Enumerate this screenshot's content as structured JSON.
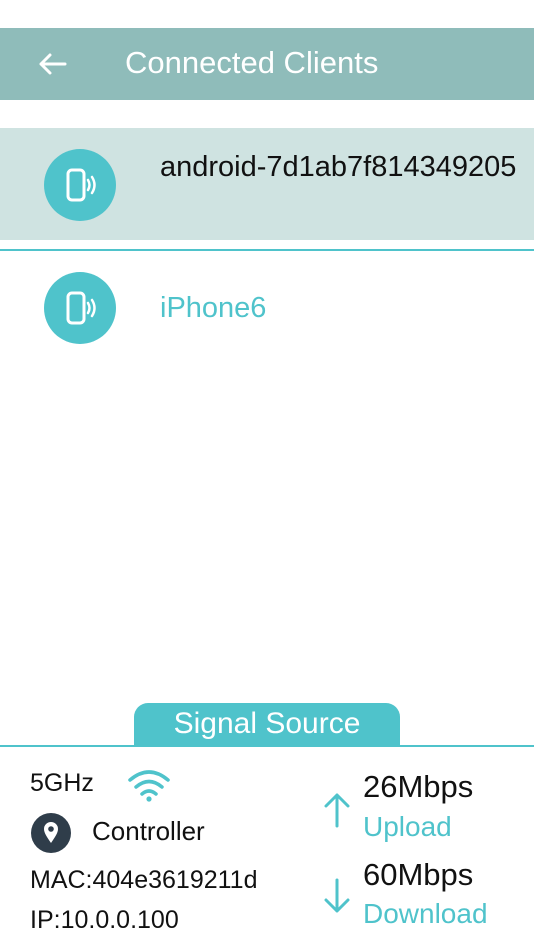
{
  "header": {
    "title": "Connected Clients",
    "back_icon": "arrow-left-icon"
  },
  "clients": [
    {
      "name": "android-7d1ab7f814349205",
      "icon": "phone-signal-icon",
      "selected": true
    },
    {
      "name": "iPhone6",
      "icon": "phone-signal-icon",
      "selected": false
    }
  ],
  "signal_source": {
    "tab_label": "Signal Source",
    "band": "5GHz",
    "role": "Controller",
    "mac": "MAC:404e3619211d",
    "ip": "IP:10.0.0.100",
    "upload_value": "26Mbps",
    "upload_label": "Upload",
    "download_value": "60Mbps",
    "download_label": "Download"
  },
  "colors": {
    "header_bg": "#8fbcba",
    "accent": "#4fc3cb",
    "selected_row_bg": "#cfe3e1",
    "pin_icon": "#2f3d4a"
  }
}
